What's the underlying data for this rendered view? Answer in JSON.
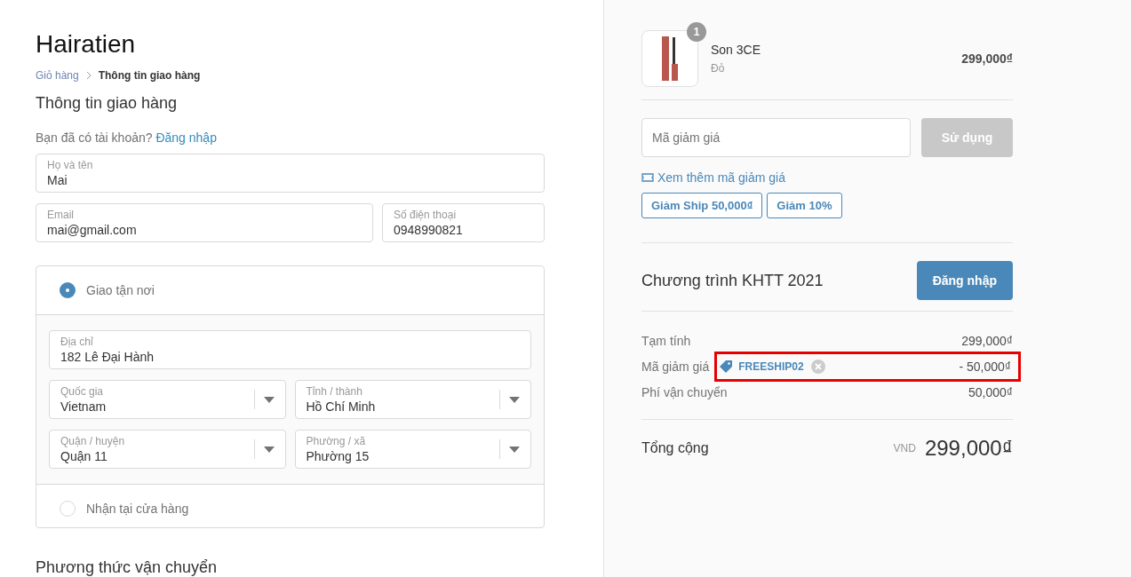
{
  "shop": {
    "name": "Hairatien"
  },
  "breadcrumb": [
    {
      "label": "Giỏ hàng",
      "selected": false
    },
    {
      "label": "Thông tin giao hàng",
      "selected": true
    }
  ],
  "section_title": "Thông tin giao hàng",
  "login_prompt": {
    "text": "Bạn đã có tài khoản?",
    "link": "Đăng nhập"
  },
  "contact_fields": [
    {
      "label": "Họ và tên",
      "value": "Mai",
      "kind": "text",
      "wide": true
    },
    {
      "label": "Email",
      "value": "mai@gmail.com",
      "kind": "text",
      "wide": false
    },
    {
      "label": "Số điện thoại",
      "value": "0948990821",
      "kind": "text",
      "wide": false
    }
  ],
  "delivery_options": [
    {
      "label": "Giao tận nơi",
      "selected": true,
      "fields": [
        {
          "label": "Địa chỉ",
          "value": "182 Lê Đại Hành",
          "kind": "text",
          "wide": true
        },
        {
          "label": "Quốc gia",
          "value": "Vietnam",
          "kind": "select",
          "wide": false
        },
        {
          "label": "Tỉnh / thành",
          "value": "Hồ Chí Minh",
          "kind": "select",
          "wide": false
        },
        {
          "label": "Quận / huyện",
          "value": "Quận 11",
          "kind": "select",
          "wide": false
        },
        {
          "label": "Phường / xã",
          "value": "Phường 15",
          "kind": "select",
          "wide": false
        }
      ]
    },
    {
      "label": "Nhận tại cửa hàng",
      "selected": false
    }
  ],
  "shipping_title": "Phương thức vận chuyển",
  "products": [
    {
      "name": "Son 3CE",
      "variant": "Đỏ",
      "quantity": "1",
      "price": "299,000₫"
    }
  ],
  "discount": {
    "placeholder": "Mã giảm giá",
    "button": "Sử dụng",
    "disabled": true,
    "more_link": "Xem thêm mã giảm giá",
    "coupons": [
      "Giảm Ship 50,000₫",
      "Giảm 10%"
    ]
  },
  "loyalty": {
    "title": "Chương trình KHTT 2021",
    "button": "Đăng nhập"
  },
  "summary": [
    {
      "label": "Tạm tính",
      "value": "299,000₫",
      "highlighted": false
    },
    {
      "label": "Mã giảm giá",
      "code": "FREESHIP02",
      "value": "- 50,000₫",
      "highlighted": true
    },
    {
      "label": "Phí vận chuyển",
      "value": "50,000₫",
      "highlighted": false
    }
  ],
  "total": {
    "label": "Tổng cộng",
    "currency": "VND",
    "value": "299,000₫"
  }
}
